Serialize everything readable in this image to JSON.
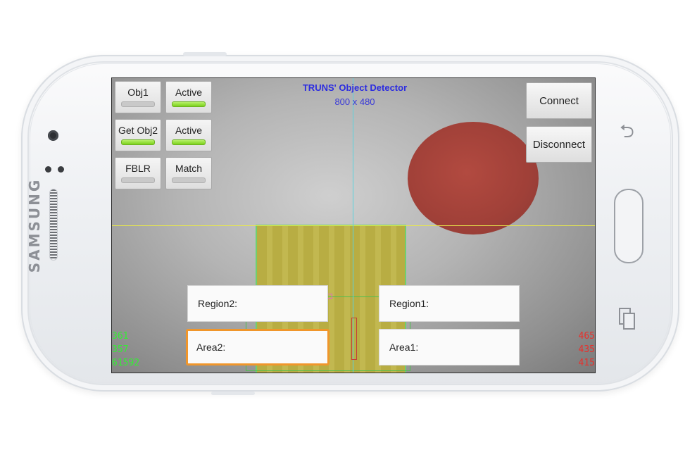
{
  "device": {
    "brand": "SAMSUNG"
  },
  "app": {
    "title": "TRUNS' Object Detector",
    "resolution": "800 x 480"
  },
  "toggles": [
    {
      "label": "Obj1",
      "on": false
    },
    {
      "label": "Active",
      "on": true
    },
    {
      "label": "Get Obj2",
      "on": true
    },
    {
      "label": "Active",
      "on": true
    },
    {
      "label": "FBLR",
      "on": false
    },
    {
      "label": "Match",
      "on": false
    }
  ],
  "buttons": {
    "connect": "Connect",
    "disconnect": "Disconnect"
  },
  "fields": {
    "region2": "Region2:",
    "region1": "Region1:",
    "area2": "Area2:",
    "area1": "Area1:"
  },
  "stats_left": [
    "361",
    "357",
    "61592"
  ],
  "stats_right": [
    "465",
    "435",
    "415"
  ],
  "colors": {
    "toggle_on": "#7cd21c",
    "title": "#2c2ce0",
    "stats_left": "#33ee33",
    "stats_right": "#e8302c",
    "focus_border": "#f0962b"
  },
  "icons": {
    "back": "back-arrow-icon",
    "recent": "recent-apps-icon"
  }
}
